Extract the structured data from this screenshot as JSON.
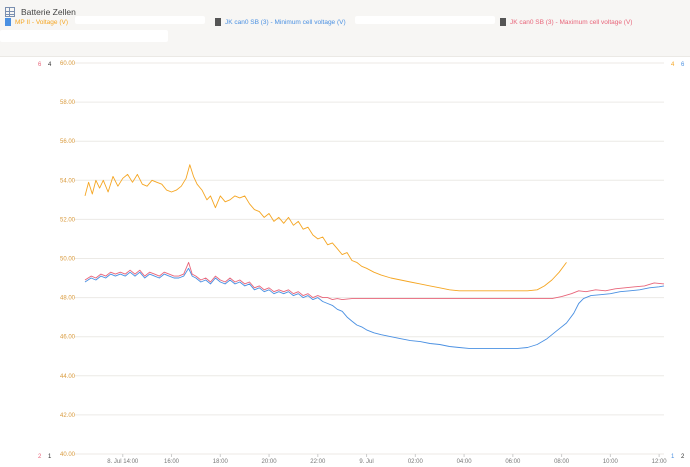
{
  "widget": {
    "title": "Batterie Zellen",
    "icon": "table-icon"
  },
  "legend": [
    {
      "label": "MP II - Voltage (V)",
      "color": "#f5a623",
      "swatch": "#4a90e2"
    },
    {
      "label": "JK can0 SB (3) - Minimum cell voltage (V)",
      "color": "#4a90e2",
      "swatch": "#555555"
    },
    {
      "label": "JK can0 SB (3) - Maximum cell voltage (V)",
      "color": "#e8657a",
      "swatch": "#555555"
    }
  ],
  "axis_labels": {
    "left_top": [
      "6",
      "4"
    ],
    "left_bottom": [
      "2",
      "1"
    ],
    "right_top": [
      "4",
      "6"
    ],
    "right_bottom": [
      "1",
      "2"
    ]
  },
  "chart_data": {
    "type": "line",
    "ylim": [
      40,
      60
    ],
    "yticks": [
      "40.00",
      "42.00",
      "44.00",
      "46.00",
      "48.00",
      "50.00",
      "52.00",
      "54.00",
      "56.00",
      "58.00",
      "60.00"
    ],
    "xlim": [
      12.0,
      36.2
    ],
    "xticks": [
      {
        "x": 14,
        "label": "8. Jul 14:00"
      },
      {
        "x": 16,
        "label": "16:00"
      },
      {
        "x": 18,
        "label": "18:00"
      },
      {
        "x": 20,
        "label": "20:00"
      },
      {
        "x": 22,
        "label": "22:00"
      },
      {
        "x": 24,
        "label": "9. Jul"
      },
      {
        "x": 26,
        "label": "02:00"
      },
      {
        "x": 28,
        "label": "04:00"
      },
      {
        "x": 30,
        "label": "06:00"
      },
      {
        "x": 32,
        "label": "08:00"
      },
      {
        "x": 34,
        "label": "10:00"
      },
      {
        "x": 36,
        "label": "12:00"
      }
    ],
    "series": [
      {
        "name": "MP II - Voltage (V)",
        "color": "#f5a623",
        "points": [
          [
            12.45,
            53.2
          ],
          [
            12.6,
            53.9
          ],
          [
            12.75,
            53.3
          ],
          [
            12.9,
            54.0
          ],
          [
            13.05,
            53.6
          ],
          [
            13.2,
            54.0
          ],
          [
            13.4,
            53.4
          ],
          [
            13.6,
            54.2
          ],
          [
            13.8,
            53.7
          ],
          [
            14.0,
            54.1
          ],
          [
            14.2,
            54.3
          ],
          [
            14.4,
            53.9
          ],
          [
            14.6,
            54.3
          ],
          [
            14.8,
            53.8
          ],
          [
            15.0,
            53.7
          ],
          [
            15.2,
            54.0
          ],
          [
            15.4,
            53.9
          ],
          [
            15.6,
            53.8
          ],
          [
            15.8,
            53.5
          ],
          [
            16.0,
            53.4
          ],
          [
            16.2,
            53.5
          ],
          [
            16.4,
            53.7
          ],
          [
            16.6,
            54.1
          ],
          [
            16.75,
            54.8
          ],
          [
            16.9,
            54.2
          ],
          [
            17.05,
            53.8
          ],
          [
            17.25,
            53.5
          ],
          [
            17.45,
            53.0
          ],
          [
            17.6,
            53.2
          ],
          [
            17.8,
            52.6
          ],
          [
            18.0,
            53.2
          ],
          [
            18.2,
            52.9
          ],
          [
            18.4,
            53.0
          ],
          [
            18.6,
            53.2
          ],
          [
            18.8,
            53.1
          ],
          [
            19.0,
            53.2
          ],
          [
            19.2,
            52.8
          ],
          [
            19.4,
            52.5
          ],
          [
            19.6,
            52.4
          ],
          [
            19.8,
            52.1
          ],
          [
            20.0,
            52.3
          ],
          [
            20.2,
            51.9
          ],
          [
            20.4,
            52.1
          ],
          [
            20.6,
            51.8
          ],
          [
            20.8,
            52.1
          ],
          [
            21.0,
            51.7
          ],
          [
            21.2,
            51.9
          ],
          [
            21.4,
            51.5
          ],
          [
            21.6,
            51.6
          ],
          [
            21.8,
            51.2
          ],
          [
            22.0,
            51.0
          ],
          [
            22.2,
            51.1
          ],
          [
            22.4,
            50.7
          ],
          [
            22.6,
            50.8
          ],
          [
            22.8,
            50.5
          ],
          [
            23.0,
            50.2
          ],
          [
            23.2,
            50.3
          ],
          [
            23.4,
            49.9
          ],
          [
            23.6,
            49.8
          ],
          [
            23.8,
            49.6
          ],
          [
            24.0,
            49.5
          ],
          [
            24.3,
            49.3
          ],
          [
            24.6,
            49.15
          ],
          [
            25.0,
            49.0
          ],
          [
            25.4,
            48.9
          ],
          [
            25.8,
            48.8
          ],
          [
            26.2,
            48.7
          ],
          [
            26.6,
            48.6
          ],
          [
            27.0,
            48.5
          ],
          [
            27.4,
            48.4
          ],
          [
            27.8,
            48.35
          ],
          [
            28.2,
            48.35
          ],
          [
            28.6,
            48.35
          ],
          [
            29.0,
            48.35
          ],
          [
            29.4,
            48.35
          ],
          [
            29.8,
            48.35
          ],
          [
            30.2,
            48.35
          ],
          [
            30.6,
            48.35
          ],
          [
            31.0,
            48.4
          ],
          [
            31.3,
            48.6
          ],
          [
            31.6,
            48.9
          ],
          [
            31.9,
            49.3
          ],
          [
            32.2,
            49.8
          ]
        ]
      },
      {
        "name": "JK can0 SB (3) - Minimum cell voltage (V)",
        "color": "#4a90e2",
        "points": [
          [
            12.45,
            48.8
          ],
          [
            12.7,
            49.0
          ],
          [
            12.9,
            48.9
          ],
          [
            13.1,
            49.1
          ],
          [
            13.3,
            49.0
          ],
          [
            13.5,
            49.2
          ],
          [
            13.7,
            49.1
          ],
          [
            13.9,
            49.2
          ],
          [
            14.1,
            49.1
          ],
          [
            14.3,
            49.3
          ],
          [
            14.5,
            49.1
          ],
          [
            14.7,
            49.3
          ],
          [
            14.9,
            49.0
          ],
          [
            15.1,
            49.2
          ],
          [
            15.3,
            49.1
          ],
          [
            15.5,
            49.0
          ],
          [
            15.7,
            49.2
          ],
          [
            15.9,
            49.1
          ],
          [
            16.1,
            49.0
          ],
          [
            16.3,
            49.0
          ],
          [
            16.5,
            49.1
          ],
          [
            16.7,
            49.5
          ],
          [
            16.85,
            49.1
          ],
          [
            17.0,
            49.0
          ],
          [
            17.2,
            48.8
          ],
          [
            17.4,
            48.9
          ],
          [
            17.6,
            48.7
          ],
          [
            17.8,
            49.0
          ],
          [
            18.0,
            48.8
          ],
          [
            18.2,
            48.7
          ],
          [
            18.4,
            48.9
          ],
          [
            18.6,
            48.7
          ],
          [
            18.8,
            48.8
          ],
          [
            19.0,
            48.6
          ],
          [
            19.2,
            48.7
          ],
          [
            19.4,
            48.4
          ],
          [
            19.6,
            48.5
          ],
          [
            19.8,
            48.3
          ],
          [
            20.0,
            48.4
          ],
          [
            20.2,
            48.2
          ],
          [
            20.4,
            48.3
          ],
          [
            20.6,
            48.2
          ],
          [
            20.8,
            48.3
          ],
          [
            21.0,
            48.1
          ],
          [
            21.2,
            48.2
          ],
          [
            21.4,
            48.0
          ],
          [
            21.6,
            48.1
          ],
          [
            21.8,
            47.9
          ],
          [
            22.0,
            48.0
          ],
          [
            22.2,
            47.8
          ],
          [
            22.4,
            47.7
          ],
          [
            22.6,
            47.6
          ],
          [
            22.8,
            47.4
          ],
          [
            23.0,
            47.3
          ],
          [
            23.2,
            47.0
          ],
          [
            23.4,
            46.8
          ],
          [
            23.6,
            46.6
          ],
          [
            23.8,
            46.5
          ],
          [
            24.0,
            46.35
          ],
          [
            24.3,
            46.2
          ],
          [
            24.6,
            46.1
          ],
          [
            25.0,
            46.0
          ],
          [
            25.4,
            45.9
          ],
          [
            25.8,
            45.8
          ],
          [
            26.2,
            45.75
          ],
          [
            26.6,
            45.65
          ],
          [
            27.0,
            45.6
          ],
          [
            27.4,
            45.5
          ],
          [
            27.8,
            45.45
          ],
          [
            28.2,
            45.4
          ],
          [
            28.6,
            45.4
          ],
          [
            29.0,
            45.4
          ],
          [
            29.4,
            45.4
          ],
          [
            29.8,
            45.4
          ],
          [
            30.2,
            45.4
          ],
          [
            30.6,
            45.45
          ],
          [
            31.0,
            45.6
          ],
          [
            31.4,
            45.9
          ],
          [
            31.8,
            46.3
          ],
          [
            32.2,
            46.7
          ],
          [
            32.5,
            47.2
          ],
          [
            32.7,
            47.7
          ],
          [
            32.9,
            47.95
          ],
          [
            33.2,
            48.1
          ],
          [
            33.6,
            48.15
          ],
          [
            34.0,
            48.2
          ],
          [
            34.4,
            48.3
          ],
          [
            34.8,
            48.35
          ],
          [
            35.2,
            48.4
          ],
          [
            35.6,
            48.5
          ],
          [
            36.0,
            48.55
          ],
          [
            36.2,
            48.6
          ]
        ]
      },
      {
        "name": "JK can0 SB (3) - Maximum cell voltage (V)",
        "color": "#e8657a",
        "points": [
          [
            12.45,
            48.9
          ],
          [
            12.7,
            49.1
          ],
          [
            12.9,
            49.0
          ],
          [
            13.1,
            49.2
          ],
          [
            13.3,
            49.1
          ],
          [
            13.5,
            49.3
          ],
          [
            13.7,
            49.2
          ],
          [
            13.9,
            49.3
          ],
          [
            14.1,
            49.2
          ],
          [
            14.3,
            49.4
          ],
          [
            14.5,
            49.2
          ],
          [
            14.7,
            49.4
          ],
          [
            14.9,
            49.1
          ],
          [
            15.1,
            49.3
          ],
          [
            15.3,
            49.2
          ],
          [
            15.5,
            49.1
          ],
          [
            15.7,
            49.3
          ],
          [
            15.9,
            49.2
          ],
          [
            16.1,
            49.1
          ],
          [
            16.3,
            49.1
          ],
          [
            16.5,
            49.2
          ],
          [
            16.7,
            49.8
          ],
          [
            16.85,
            49.2
          ],
          [
            17.0,
            49.1
          ],
          [
            17.2,
            48.9
          ],
          [
            17.4,
            49.0
          ],
          [
            17.6,
            48.8
          ],
          [
            17.8,
            49.1
          ],
          [
            18.0,
            48.9
          ],
          [
            18.2,
            48.8
          ],
          [
            18.4,
            49.0
          ],
          [
            18.6,
            48.8
          ],
          [
            18.8,
            48.9
          ],
          [
            19.0,
            48.7
          ],
          [
            19.2,
            48.8
          ],
          [
            19.4,
            48.5
          ],
          [
            19.6,
            48.6
          ],
          [
            19.8,
            48.4
          ],
          [
            20.0,
            48.5
          ],
          [
            20.2,
            48.3
          ],
          [
            20.4,
            48.4
          ],
          [
            20.6,
            48.3
          ],
          [
            20.8,
            48.4
          ],
          [
            21.0,
            48.2
          ],
          [
            21.2,
            48.3
          ],
          [
            21.4,
            48.1
          ],
          [
            21.6,
            48.2
          ],
          [
            21.8,
            48.0
          ],
          [
            22.0,
            48.1
          ],
          [
            22.2,
            48.0
          ],
          [
            22.4,
            48.0
          ],
          [
            22.6,
            47.9
          ],
          [
            22.8,
            47.95
          ],
          [
            23.0,
            47.9
          ],
          [
            23.4,
            47.95
          ],
          [
            24.0,
            47.95
          ],
          [
            25.0,
            47.95
          ],
          [
            26.0,
            47.95
          ],
          [
            27.0,
            47.95
          ],
          [
            28.0,
            47.95
          ],
          [
            29.0,
            47.95
          ],
          [
            30.0,
            47.95
          ],
          [
            31.0,
            47.95
          ],
          [
            31.6,
            47.95
          ],
          [
            32.0,
            48.05
          ],
          [
            32.4,
            48.2
          ],
          [
            32.7,
            48.35
          ],
          [
            33.0,
            48.3
          ],
          [
            33.4,
            48.4
          ],
          [
            33.8,
            48.35
          ],
          [
            34.2,
            48.45
          ],
          [
            34.6,
            48.5
          ],
          [
            35.0,
            48.55
          ],
          [
            35.4,
            48.6
          ],
          [
            35.8,
            48.75
          ],
          [
            36.2,
            48.7
          ]
        ]
      }
    ]
  }
}
